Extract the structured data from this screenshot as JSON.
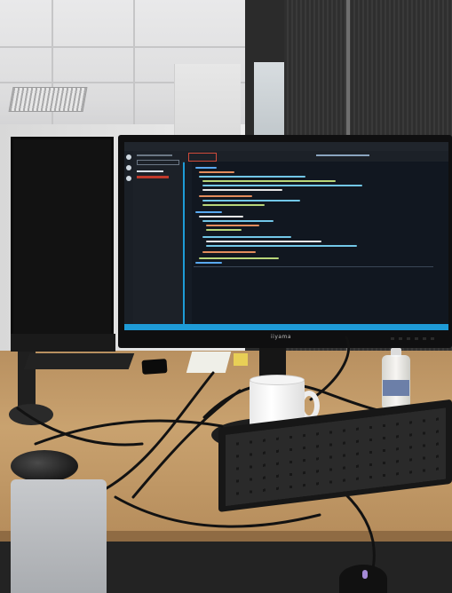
{
  "scene": {
    "monitor_brand": "iiyama",
    "colors": {
      "accent": "#1e9bd7",
      "editor_background": "#111720",
      "desk": "#c9a26f",
      "ceiling": "#e2e2e3"
    }
  }
}
